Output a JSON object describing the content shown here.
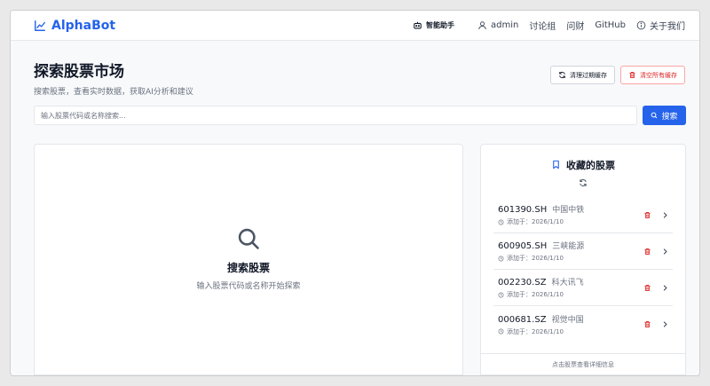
{
  "brand": {
    "name": "AlphaBot",
    "color": "#2563eb"
  },
  "nav": {
    "assistant": "智能助手",
    "user": "admin",
    "discussion": "讨论组",
    "ask": "问财",
    "github": "GitHub",
    "about": "关于我们"
  },
  "page": {
    "title": "探索股票市场",
    "subtitle": "搜索股票，查看实时数据，获取AI分析和建议",
    "clear_expired": "清理过期缓存",
    "clear_all": "清空所有缓存"
  },
  "search": {
    "placeholder": "输入股票代码或名称搜索...",
    "button": "搜索"
  },
  "empty": {
    "title": "搜索股票",
    "subtitle": "输入股票代码或名称开始探索"
  },
  "favorites": {
    "title": "收藏的股票",
    "footer": "点击股票查看详细信息",
    "items": [
      {
        "code": "601390.SH",
        "name": "中国中铁",
        "added": "添加于：2026/1/10"
      },
      {
        "code": "600905.SH",
        "name": "三峡能源",
        "added": "添加于：2026/1/10"
      },
      {
        "code": "002230.SZ",
        "name": "科大讯飞",
        "added": "添加于：2026/1/10"
      },
      {
        "code": "000681.SZ",
        "name": "视觉中国",
        "added": "添加于：2026/1/10"
      }
    ]
  },
  "colors": {
    "primary": "#2563eb",
    "danger": "#dc2626"
  }
}
